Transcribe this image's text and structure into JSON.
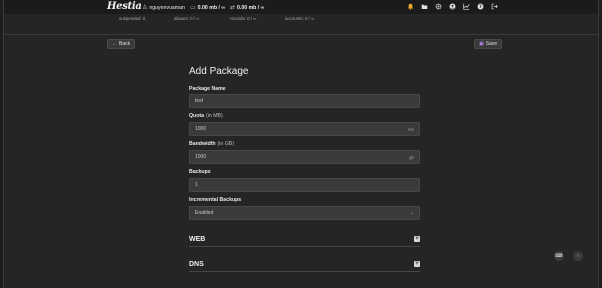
{
  "topbar": {
    "logo": "Hestia",
    "user": "nguyenvuaman",
    "disk": "0.00 mb / ∞",
    "bandwidth": "0.00 mb / ∞",
    "icons": [
      "bell-icon",
      "folder-icon",
      "gear-icon",
      "user-circle-icon",
      "chart-icon",
      "help-icon",
      "logout-icon"
    ]
  },
  "stats": {
    "suspended": "suspended: 0",
    "aliases": "aliases: 0 / ∞",
    "records": "records: 0 / ∞",
    "accounts": "accounts: 0 / ∞"
  },
  "toolbar": {
    "back_label": "Back",
    "save_label": "Save"
  },
  "form": {
    "title": "Add Package",
    "package_name": {
      "label": "Package Name",
      "value": "test"
    },
    "quota": {
      "label": "Quota",
      "sub": "(in MB)",
      "value": "1000",
      "suffix": "mb"
    },
    "bandwidth": {
      "label": "Bandwidth",
      "sub": "(in GB)",
      "value": "1000",
      "suffix": "gb"
    },
    "backups": {
      "label": "Backups",
      "value": "1"
    },
    "incremental": {
      "label": "Incremental Backups",
      "value": "Enabled"
    },
    "sections": [
      "WEB",
      "DNS"
    ]
  },
  "colors": {
    "background": "#252525",
    "topbar": "#1b1b1b",
    "field": "#3a3a3a",
    "accent_back": "#8fb5ff",
    "accent_save": "#c38cff"
  }
}
